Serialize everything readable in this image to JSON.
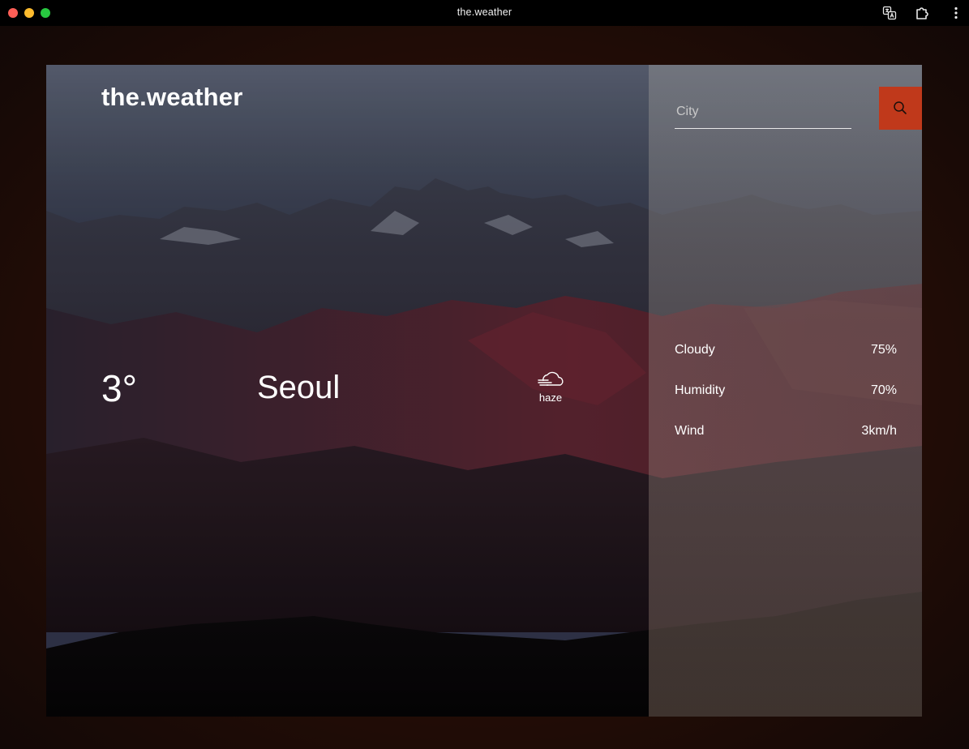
{
  "window": {
    "title": "the.weather"
  },
  "app": {
    "logo": "the.weather",
    "search": {
      "placeholder": "City",
      "value": ""
    },
    "current": {
      "temperature": "3°",
      "city": "Seoul",
      "condition": "haze",
      "condition_icon": "haze-cloud-icon"
    },
    "details": [
      {
        "label": "Cloudy",
        "value": "75%"
      },
      {
        "label": "Humidity",
        "value": "70%"
      },
      {
        "label": "Wind",
        "value": "3km/h"
      }
    ]
  },
  "colors": {
    "accent": "#c0391b",
    "text": "#ffffff",
    "titlebar": "#000000"
  }
}
